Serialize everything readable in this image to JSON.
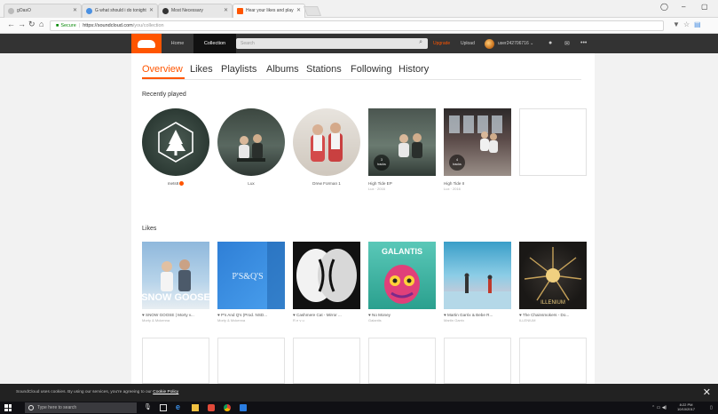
{
  "browser": {
    "tabs": [
      {
        "label": "gOasO"
      },
      {
        "label": "G what should i do tonight"
      },
      {
        "label": "Most Necessary"
      },
      {
        "label": "Hear your likes and play"
      }
    ],
    "url": {
      "secure_label": "Secure",
      "host": "https://soundcloud.com",
      "path": "/you/collection"
    }
  },
  "header": {
    "nav": [
      {
        "label": "Home"
      },
      {
        "label": "Collection"
      }
    ],
    "search_placeholder": "Search",
    "upgrade_label": "Upgrade",
    "upload_label": "Upload",
    "username": "user242706716"
  },
  "collection_tabs": [
    {
      "label": "Overview",
      "active": true
    },
    {
      "label": "Likes"
    },
    {
      "label": "Playlists"
    },
    {
      "label": "Albums"
    },
    {
      "label": "Stations"
    },
    {
      "label": "Following"
    },
    {
      "label": "History"
    }
  ],
  "recently_played": {
    "title": "Recently played",
    "items": [
      {
        "title": "mets8",
        "round": true
      },
      {
        "title": "Lux",
        "round": true
      },
      {
        "title": "Drew Forman 1",
        "round": true
      },
      {
        "title": "High Tide EP",
        "subtitle": "Lux · 2016",
        "tracks_count": "3",
        "tracks_label": "tracks"
      },
      {
        "title": "High Tide II",
        "subtitle": "Lux · 2016",
        "tracks_count": "4",
        "tracks_label": "tracks"
      },
      {
        "title": ""
      }
    ]
  },
  "likes": {
    "title": "Likes",
    "items": [
      {
        "title": "SNOW GOOSE | Morty v...",
        "artist": "Morty & Mckenna",
        "art_text": "SNOW GOOSE"
      },
      {
        "title": "P's And Q's (Prod. NSD...",
        "artist": "Morty & Mckenna",
        "art_text": "P'S&Q'S"
      },
      {
        "title": "Cashmere Cat - Mirror ...",
        "artist": "R e v u"
      },
      {
        "title": "No Money",
        "artist": "Galantis",
        "art_text": "GALANTIS"
      },
      {
        "title": "Martin Garrix & Bebe R...",
        "artist": "Martin Garrix"
      },
      {
        "title": "The Chainsmokers - Do...",
        "artist": "ILLENIUM",
        "art_text": "ILLENIUM"
      }
    ]
  },
  "cookie_bar": {
    "text": "SoundCloud uses cookies. By using our services, you're agreeing to our",
    "link": "Cookie Policy"
  },
  "taskbar": {
    "search_placeholder": "Type here to search",
    "time": "8:22 PM",
    "date": "10/10/2017"
  },
  "colors": {
    "accent": "#ff5500",
    "header_bg": "#333333",
    "page_bg": "#f2f2f2"
  }
}
